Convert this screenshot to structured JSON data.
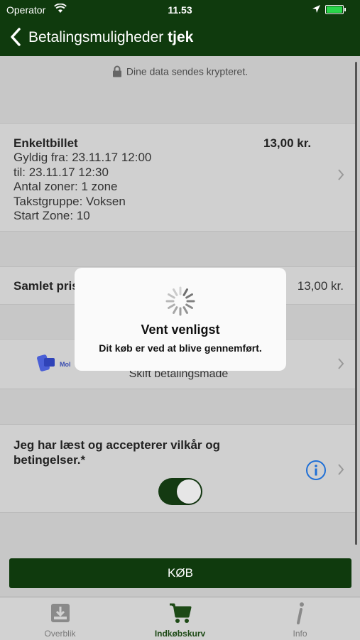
{
  "status_bar": {
    "carrier": "Operator",
    "time": "11.53"
  },
  "nav": {
    "title_main": "Betalingsmuligheder",
    "title_bold": "tjek"
  },
  "encryption_note": "Dine data sendes krypteret.",
  "ticket": {
    "name": "Enkeltbillet",
    "price": "13,00 kr.",
    "valid_from": "Gyldig fra: 23.11.17 12:00",
    "valid_to": "til: 23.11.17 12:30",
    "zones": "Antal zoner: 1 zone",
    "group": "Takstgruppe: Voksen",
    "start_zone": "Start Zone: 10"
  },
  "total": {
    "label": "Samlet pris",
    "value": "13,00 kr."
  },
  "payment": {
    "logo_text": "Mol",
    "label": "Skift betalingsmåde"
  },
  "terms": {
    "label": "Jeg har læst og accepterer vilkår og betingelser.*",
    "accepted": true
  },
  "buy_button": "KØB",
  "tabs": [
    {
      "label": "Overblik",
      "icon": "download-tray-icon"
    },
    {
      "label": "Indkøbskurv",
      "icon": "cart-icon",
      "active": true
    },
    {
      "label": "Info",
      "icon": "info-icon"
    }
  ],
  "modal": {
    "title": "Vent venligst",
    "message": "Dit køb er ved at blive gennemført."
  },
  "colors": {
    "primary": "#0f3a0d",
    "background": "#c7c7c7",
    "info_blue": "#1f6fd6"
  }
}
